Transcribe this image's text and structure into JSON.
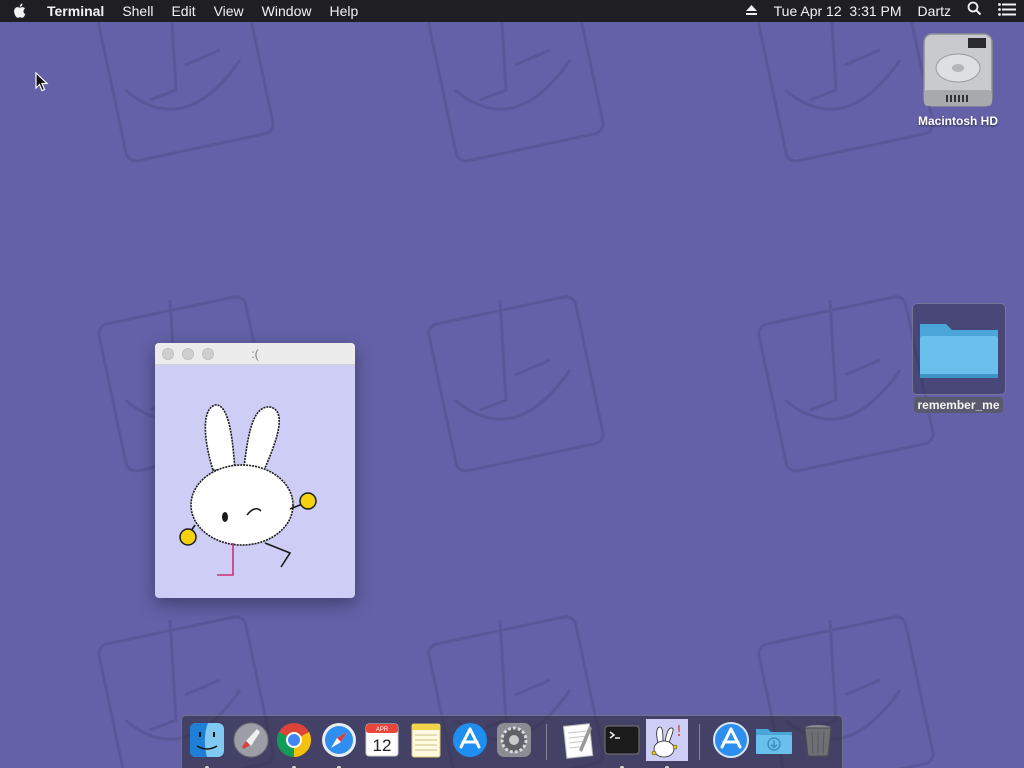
{
  "menubar": {
    "app_name": "Terminal",
    "items": [
      "Shell",
      "Edit",
      "View",
      "Window",
      "Help"
    ],
    "date": "Tue Apr 12",
    "time": "3:31 PM",
    "user": "Dartz"
  },
  "desktop": {
    "icons": [
      {
        "label": "Macintosh HD",
        "icon": "hard-drive-icon"
      },
      {
        "label": "remember_me",
        "icon": "folder-icon"
      }
    ]
  },
  "window": {
    "title": ":(",
    "background": "#cecdf5"
  },
  "dock": {
    "calendar_month": "APR",
    "calendar_day": "12",
    "items": [
      {
        "name": "Finder",
        "icon": "finder-icon",
        "running": true
      },
      {
        "name": "Launchpad",
        "icon": "launchpad-icon",
        "running": false
      },
      {
        "name": "Chrome",
        "icon": "chrome-icon",
        "running": true
      },
      {
        "name": "Safari",
        "icon": "safari-icon",
        "running": true
      },
      {
        "name": "Calendar",
        "icon": "calendar-icon",
        "running": false
      },
      {
        "name": "Notes",
        "icon": "notes-icon",
        "running": false
      },
      {
        "name": "App Store",
        "icon": "app-store-icon",
        "running": false
      },
      {
        "name": "System Preferences",
        "icon": "system-preferences-icon",
        "running": false
      },
      {
        "name": "TextEdit",
        "icon": "textedit-icon",
        "running": false
      },
      {
        "name": "Terminal",
        "icon": "terminal-icon",
        "running": true
      },
      {
        "name": "Bunny",
        "icon": "bunny-app-icon",
        "running": true
      },
      {
        "name": "Applications",
        "icon": "applications-folder-icon",
        "running": false
      },
      {
        "name": "Downloads",
        "icon": "downloads-folder-icon",
        "running": false
      },
      {
        "name": "Trash",
        "icon": "trash-icon",
        "running": false
      }
    ]
  },
  "colors": {
    "wallpaper": "#6461a8",
    "menubar": "#1f1e22",
    "accent_yellow": "#f5d20f"
  }
}
